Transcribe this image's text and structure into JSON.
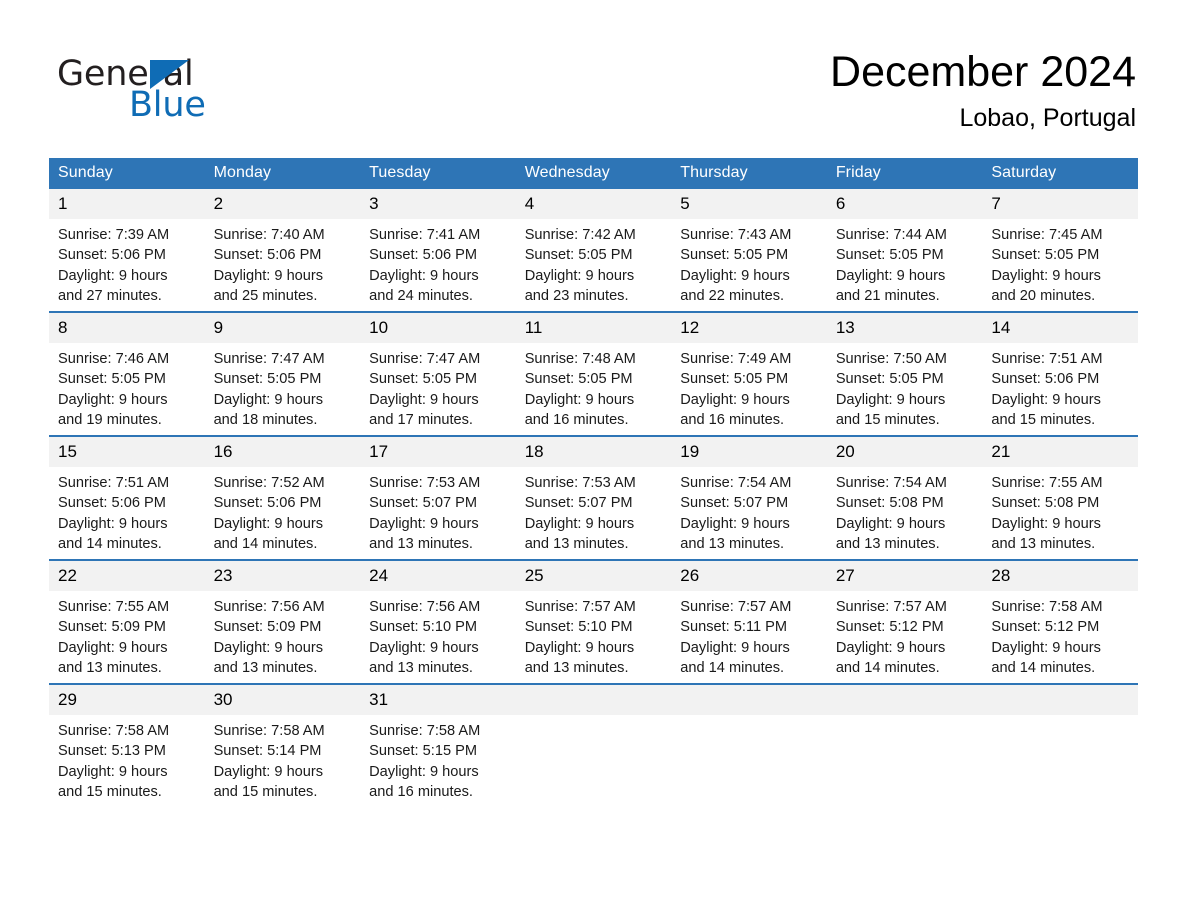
{
  "brand": {
    "name_part1": "General",
    "name_part2": "Blue",
    "accent_color": "#0f6cb5"
  },
  "header": {
    "title": "December 2024",
    "subtitle": "Lobao, Portugal",
    "header_bg_color": "#2e75b6",
    "daynum_bg_color": "#f2f2f2"
  },
  "weekday_headers": [
    "Sunday",
    "Monday",
    "Tuesday",
    "Wednesday",
    "Thursday",
    "Friday",
    "Saturday"
  ],
  "weeks": [
    {
      "days": [
        {
          "num": "1",
          "sunrise": "Sunrise: 7:39 AM",
          "sunset": "Sunset: 5:06 PM",
          "daylight_line1": "Daylight: 9 hours",
          "daylight_line2": "and 27 minutes."
        },
        {
          "num": "2",
          "sunrise": "Sunrise: 7:40 AM",
          "sunset": "Sunset: 5:06 PM",
          "daylight_line1": "Daylight: 9 hours",
          "daylight_line2": "and 25 minutes."
        },
        {
          "num": "3",
          "sunrise": "Sunrise: 7:41 AM",
          "sunset": "Sunset: 5:06 PM",
          "daylight_line1": "Daylight: 9 hours",
          "daylight_line2": "and 24 minutes."
        },
        {
          "num": "4",
          "sunrise": "Sunrise: 7:42 AM",
          "sunset": "Sunset: 5:05 PM",
          "daylight_line1": "Daylight: 9 hours",
          "daylight_line2": "and 23 minutes."
        },
        {
          "num": "5",
          "sunrise": "Sunrise: 7:43 AM",
          "sunset": "Sunset: 5:05 PM",
          "daylight_line1": "Daylight: 9 hours",
          "daylight_line2": "and 22 minutes."
        },
        {
          "num": "6",
          "sunrise": "Sunrise: 7:44 AM",
          "sunset": "Sunset: 5:05 PM",
          "daylight_line1": "Daylight: 9 hours",
          "daylight_line2": "and 21 minutes."
        },
        {
          "num": "7",
          "sunrise": "Sunrise: 7:45 AM",
          "sunset": "Sunset: 5:05 PM",
          "daylight_line1": "Daylight: 9 hours",
          "daylight_line2": "and 20 minutes."
        }
      ]
    },
    {
      "days": [
        {
          "num": "8",
          "sunrise": "Sunrise: 7:46 AM",
          "sunset": "Sunset: 5:05 PM",
          "daylight_line1": "Daylight: 9 hours",
          "daylight_line2": "and 19 minutes."
        },
        {
          "num": "9",
          "sunrise": "Sunrise: 7:47 AM",
          "sunset": "Sunset: 5:05 PM",
          "daylight_line1": "Daylight: 9 hours",
          "daylight_line2": "and 18 minutes."
        },
        {
          "num": "10",
          "sunrise": "Sunrise: 7:47 AM",
          "sunset": "Sunset: 5:05 PM",
          "daylight_line1": "Daylight: 9 hours",
          "daylight_line2": "and 17 minutes."
        },
        {
          "num": "11",
          "sunrise": "Sunrise: 7:48 AM",
          "sunset": "Sunset: 5:05 PM",
          "daylight_line1": "Daylight: 9 hours",
          "daylight_line2": "and 16 minutes."
        },
        {
          "num": "12",
          "sunrise": "Sunrise: 7:49 AM",
          "sunset": "Sunset: 5:05 PM",
          "daylight_line1": "Daylight: 9 hours",
          "daylight_line2": "and 16 minutes."
        },
        {
          "num": "13",
          "sunrise": "Sunrise: 7:50 AM",
          "sunset": "Sunset: 5:05 PM",
          "daylight_line1": "Daylight: 9 hours",
          "daylight_line2": "and 15 minutes."
        },
        {
          "num": "14",
          "sunrise": "Sunrise: 7:51 AM",
          "sunset": "Sunset: 5:06 PM",
          "daylight_line1": "Daylight: 9 hours",
          "daylight_line2": "and 15 minutes."
        }
      ]
    },
    {
      "days": [
        {
          "num": "15",
          "sunrise": "Sunrise: 7:51 AM",
          "sunset": "Sunset: 5:06 PM",
          "daylight_line1": "Daylight: 9 hours",
          "daylight_line2": "and 14 minutes."
        },
        {
          "num": "16",
          "sunrise": "Sunrise: 7:52 AM",
          "sunset": "Sunset: 5:06 PM",
          "daylight_line1": "Daylight: 9 hours",
          "daylight_line2": "and 14 minutes."
        },
        {
          "num": "17",
          "sunrise": "Sunrise: 7:53 AM",
          "sunset": "Sunset: 5:07 PM",
          "daylight_line1": "Daylight: 9 hours",
          "daylight_line2": "and 13 minutes."
        },
        {
          "num": "18",
          "sunrise": "Sunrise: 7:53 AM",
          "sunset": "Sunset: 5:07 PM",
          "daylight_line1": "Daylight: 9 hours",
          "daylight_line2": "and 13 minutes."
        },
        {
          "num": "19",
          "sunrise": "Sunrise: 7:54 AM",
          "sunset": "Sunset: 5:07 PM",
          "daylight_line1": "Daylight: 9 hours",
          "daylight_line2": "and 13 minutes."
        },
        {
          "num": "20",
          "sunrise": "Sunrise: 7:54 AM",
          "sunset": "Sunset: 5:08 PM",
          "daylight_line1": "Daylight: 9 hours",
          "daylight_line2": "and 13 minutes."
        },
        {
          "num": "21",
          "sunrise": "Sunrise: 7:55 AM",
          "sunset": "Sunset: 5:08 PM",
          "daylight_line1": "Daylight: 9 hours",
          "daylight_line2": "and 13 minutes."
        }
      ]
    },
    {
      "days": [
        {
          "num": "22",
          "sunrise": "Sunrise: 7:55 AM",
          "sunset": "Sunset: 5:09 PM",
          "daylight_line1": "Daylight: 9 hours",
          "daylight_line2": "and 13 minutes."
        },
        {
          "num": "23",
          "sunrise": "Sunrise: 7:56 AM",
          "sunset": "Sunset: 5:09 PM",
          "daylight_line1": "Daylight: 9 hours",
          "daylight_line2": "and 13 minutes."
        },
        {
          "num": "24",
          "sunrise": "Sunrise: 7:56 AM",
          "sunset": "Sunset: 5:10 PM",
          "daylight_line1": "Daylight: 9 hours",
          "daylight_line2": "and 13 minutes."
        },
        {
          "num": "25",
          "sunrise": "Sunrise: 7:57 AM",
          "sunset": "Sunset: 5:10 PM",
          "daylight_line1": "Daylight: 9 hours",
          "daylight_line2": "and 13 minutes."
        },
        {
          "num": "26",
          "sunrise": "Sunrise: 7:57 AM",
          "sunset": "Sunset: 5:11 PM",
          "daylight_line1": "Daylight: 9 hours",
          "daylight_line2": "and 14 minutes."
        },
        {
          "num": "27",
          "sunrise": "Sunrise: 7:57 AM",
          "sunset": "Sunset: 5:12 PM",
          "daylight_line1": "Daylight: 9 hours",
          "daylight_line2": "and 14 minutes."
        },
        {
          "num": "28",
          "sunrise": "Sunrise: 7:58 AM",
          "sunset": "Sunset: 5:12 PM",
          "daylight_line1": "Daylight: 9 hours",
          "daylight_line2": "and 14 minutes."
        }
      ]
    },
    {
      "days": [
        {
          "num": "29",
          "sunrise": "Sunrise: 7:58 AM",
          "sunset": "Sunset: 5:13 PM",
          "daylight_line1": "Daylight: 9 hours",
          "daylight_line2": "and 15 minutes."
        },
        {
          "num": "30",
          "sunrise": "Sunrise: 7:58 AM",
          "sunset": "Sunset: 5:14 PM",
          "daylight_line1": "Daylight: 9 hours",
          "daylight_line2": "and 15 minutes."
        },
        {
          "num": "31",
          "sunrise": "Sunrise: 7:58 AM",
          "sunset": "Sunset: 5:15 PM",
          "daylight_line1": "Daylight: 9 hours",
          "daylight_line2": "and 16 minutes."
        },
        {
          "num": "",
          "sunrise": "",
          "sunset": "",
          "daylight_line1": "",
          "daylight_line2": ""
        },
        {
          "num": "",
          "sunrise": "",
          "sunset": "",
          "daylight_line1": "",
          "daylight_line2": ""
        },
        {
          "num": "",
          "sunrise": "",
          "sunset": "",
          "daylight_line1": "",
          "daylight_line2": ""
        },
        {
          "num": "",
          "sunrise": "",
          "sunset": "",
          "daylight_line1": "",
          "daylight_line2": ""
        }
      ]
    }
  ]
}
